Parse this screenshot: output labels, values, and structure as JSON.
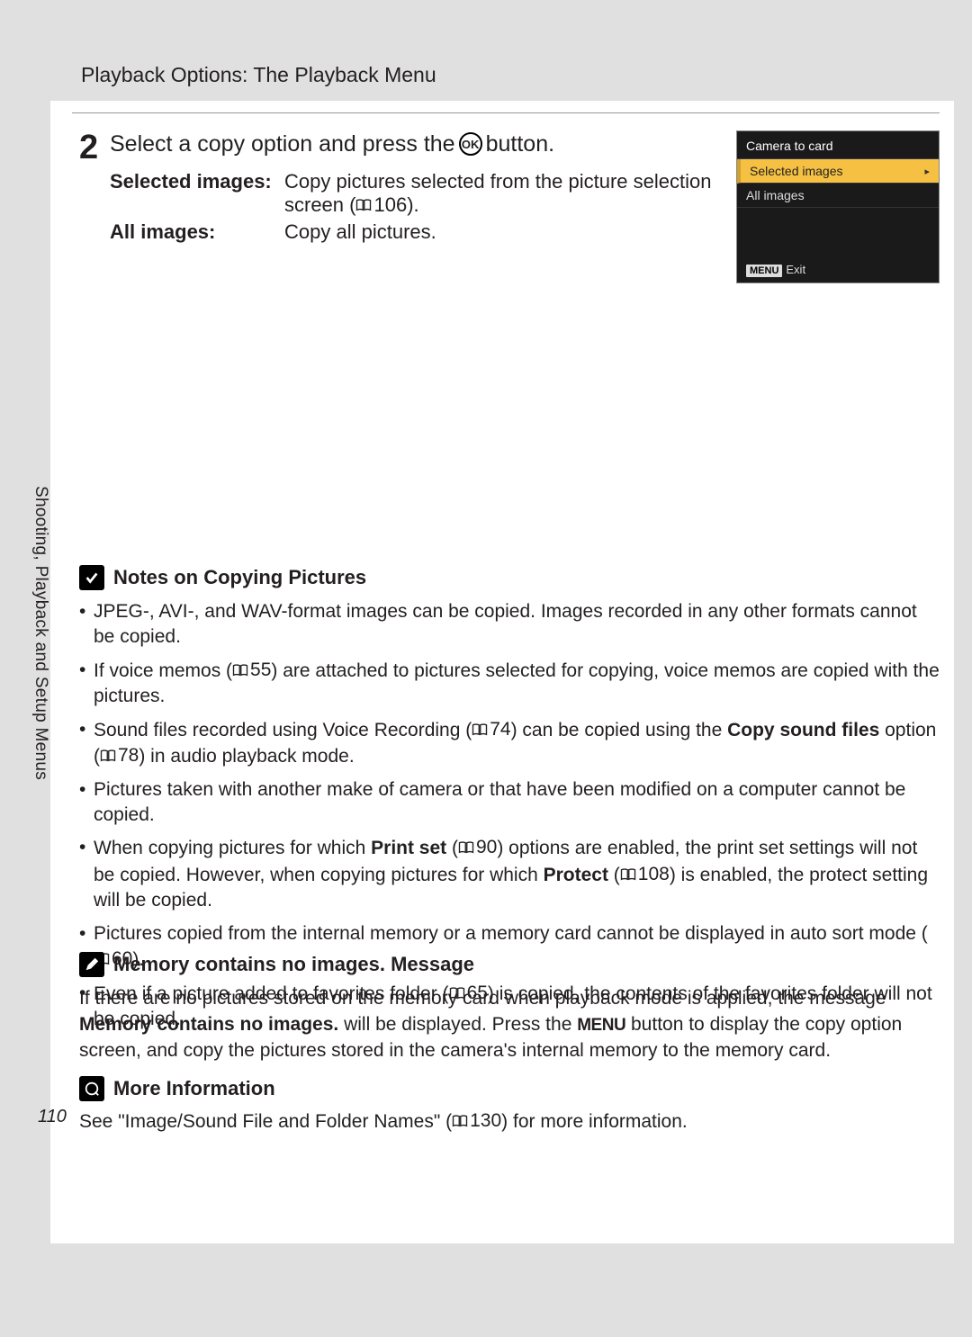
{
  "header": {
    "title": "Playback Options: The Playback Menu"
  },
  "sidebar": {
    "vertical_label": "Shooting, Playback and Setup Menus"
  },
  "step": {
    "number": "2",
    "title_pre": "Select a copy option and press the ",
    "ok_label": "OK",
    "title_post": " button.",
    "defs": [
      {
        "term": "Selected images:",
        "desc_pre": "Copy pictures selected from the picture selection screen (",
        "ref": "106",
        "desc_post": ")."
      },
      {
        "term": "All images:",
        "desc": "Copy all pictures."
      }
    ]
  },
  "camera_panel": {
    "title": "Camera to card",
    "items": [
      {
        "label": "Selected images",
        "selected": true
      },
      {
        "label": "All images",
        "selected": false
      }
    ],
    "exit_label": "Exit",
    "menu_badge": "MENU"
  },
  "notes": {
    "heading": "Notes on Copying Pictures",
    "items": [
      {
        "parts": [
          {
            "t": "JPEG-, AVI-, and WAV-format images can be copied. Images recorded in any other formats cannot be copied."
          }
        ]
      },
      {
        "parts": [
          {
            "t": "If voice memos ("
          },
          {
            "ref": "55"
          },
          {
            "t": ") are attached to pictures selected for copying, voice memos are copied with the pictures."
          }
        ]
      },
      {
        "parts": [
          {
            "t": "Sound files recorded using Voice Recording ("
          },
          {
            "ref": "74"
          },
          {
            "t": ") can be copied using the "
          },
          {
            "b": "Copy sound files"
          },
          {
            "t": " option ("
          },
          {
            "ref": "78"
          },
          {
            "t": ") in audio playback mode."
          }
        ]
      },
      {
        "parts": [
          {
            "t": "Pictures taken with another make of camera or that have been modified on a computer cannot be copied."
          }
        ]
      },
      {
        "parts": [
          {
            "t": "When copying pictures for which "
          },
          {
            "b": "Print set"
          },
          {
            "t": " ("
          },
          {
            "ref": "90"
          },
          {
            "t": ") options are enabled, the print set settings will not be copied. However, when copying pictures for which "
          },
          {
            "b": "Protect"
          },
          {
            "t": " ("
          },
          {
            "ref": "108"
          },
          {
            "t": ") is enabled, the protect setting will be copied."
          }
        ]
      },
      {
        "parts": [
          {
            "t": "Pictures copied from the internal memory or a memory card cannot be displayed in auto sort mode ("
          },
          {
            "ref": "60"
          },
          {
            "t": ")."
          }
        ]
      },
      {
        "parts": [
          {
            "t": "Even if a picture added to favorites folder ("
          },
          {
            "ref": "65"
          },
          {
            "t": ") is copied, the contents of the favorites folder will not be copied."
          }
        ]
      }
    ]
  },
  "message": {
    "heading": "Memory contains no images. Message",
    "body_pre": "If there are no pictures stored on the memory card when playback mode is applied, the message ",
    "body_bold": "Memory contains no images.",
    "body_mid": " will be displayed. Press the ",
    "menu_word": "MENU",
    "body_post": " button to display the copy option screen, and copy the pictures stored in the camera's internal memory to the memory card."
  },
  "more": {
    "heading": "More Information",
    "body_pre": "See \"Image/Sound File and Folder Names\" (",
    "ref": "130",
    "body_post": ") for more information."
  },
  "page_number": "110"
}
